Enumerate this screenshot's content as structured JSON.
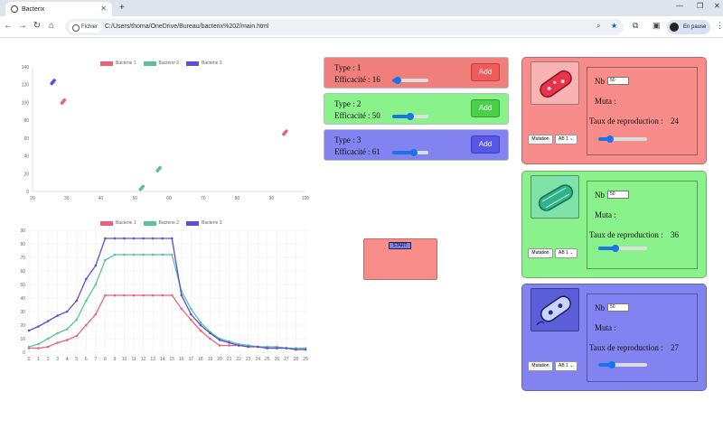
{
  "browser": {
    "tab_title": "Bacterix",
    "tab_close": "✕",
    "new_tab": "+",
    "chip": "Fichier",
    "url": "C:/Users/thoma/OneDrive/Bureau/bacterix%202/main.html",
    "profile": "En pause",
    "win_min": "—",
    "win_restore": "❐",
    "back_glyph": "←",
    "forward_glyph": "→",
    "reload_glyph": "↻",
    "home_glyph": "⌂",
    "zoom_glyph": "⌕",
    "star_glyph": "★",
    "ext_glyph": "⧉",
    "panel_glyph": "▣",
    "menu_glyph": "⋮"
  },
  "colors": {
    "red": "#f07f7c",
    "green": "#8af28a",
    "blue": "#8283f0",
    "series1": "#e8627c",
    "series2": "#5cc19a",
    "series3": "#5b4fd6",
    "add_red": "#f05a5a",
    "add_green": "#4bd04b",
    "add_blue": "#5656e8"
  },
  "types": [
    {
      "type_label": "Type : 1",
      "eff_label": "Efficacité : 16",
      "eff_value": 16,
      "add_label": "Add"
    },
    {
      "type_label": "Type : 2",
      "eff_label": "Efficacité : 50",
      "eff_value": 50,
      "add_label": "Add"
    },
    {
      "type_label": "Type : 3",
      "eff_label": "Efficacité : 61",
      "eff_value": 61,
      "add_label": "Add"
    }
  ],
  "start_label": "START",
  "cards": [
    {
      "nb_label": "Nb :",
      "nb_value": "50",
      "muta_label": "Muta :",
      "taux_label": "Taux de reproduction :",
      "taux_value": "24",
      "mutation_label": "Mutation",
      "select_value": "AB 1",
      "img": "red-bacterium-image"
    },
    {
      "nb_label": "Nb :",
      "nb_value": "50",
      "muta_label": "Muta :",
      "taux_label": "Taux de reproduction :",
      "taux_value": "36",
      "mutation_label": "Mutation",
      "select_value": "AB 1",
      "img": "green-bacterium-image"
    },
    {
      "nb_label": "Nb :",
      "nb_value": "50",
      "muta_label": "Muta :",
      "taux_label": "Taux de reproduction :",
      "taux_value": "27",
      "mutation_label": "Mutation",
      "select_value": "AB 1",
      "img": "blue-bacterium-image"
    }
  ],
  "chart_data": [
    {
      "type": "scatter",
      "series": [
        {
          "name": "Bacterie 1",
          "points": [
            [
              29,
              101
            ],
            [
              94,
              66
            ]
          ]
        },
        {
          "name": "Bacterie 2",
          "points": [
            [
              52,
              4
            ],
            [
              57,
              25
            ]
          ]
        },
        {
          "name": "Bacterie 3",
          "points": [
            [
              26,
              123
            ]
          ]
        }
      ],
      "x_ticks": [
        "20",
        "30",
        "40",
        "50",
        "60",
        "70",
        "80",
        "90",
        "100"
      ],
      "y_ticks": [
        "0",
        "20",
        "40",
        "60",
        "80",
        "100",
        "120",
        "140"
      ],
      "xlim": [
        20,
        100
      ],
      "ylim": [
        0,
        140
      ],
      "grid": false,
      "legend": "top"
    },
    {
      "type": "line",
      "categories": [
        "0",
        "1",
        "2",
        "3",
        "4",
        "5",
        "6",
        "7",
        "8",
        "9",
        "10",
        "11",
        "12",
        "13",
        "14",
        "15",
        "16",
        "17",
        "18",
        "19",
        "20",
        "21",
        "22",
        "23",
        "24",
        "25",
        "26",
        "27",
        "28",
        "29"
      ],
      "series": [
        {
          "name": "Bacterie 1",
          "values": [
            3,
            3,
            4,
            7,
            9,
            12,
            20,
            28,
            42,
            42,
            42,
            42,
            42,
            42,
            42,
            42,
            32,
            24,
            16,
            10,
            5,
            5,
            5,
            5,
            4,
            3,
            3,
            3,
            2,
            2
          ]
        },
        {
          "name": "Bacterie 2",
          "values": [
            4,
            6,
            10,
            14,
            17,
            24,
            38,
            50,
            68,
            72,
            72,
            72,
            72,
            72,
            72,
            72,
            45,
            32,
            22,
            15,
            10,
            8,
            6,
            5,
            4,
            4,
            4,
            3,
            3,
            3
          ]
        },
        {
          "name": "Bacterie 3",
          "values": [
            16,
            19,
            23,
            27,
            30,
            38,
            54,
            64,
            84,
            84,
            84,
            84,
            84,
            84,
            84,
            84,
            42,
            28,
            20,
            14,
            9,
            7,
            5,
            4,
            4,
            3,
            3,
            3,
            2,
            2
          ]
        }
      ],
      "y_ticks": [
        "0",
        "10",
        "20",
        "30",
        "40",
        "50",
        "60",
        "70",
        "80",
        "90"
      ],
      "ylim": [
        0,
        90
      ],
      "grid": true,
      "legend": "top"
    }
  ]
}
